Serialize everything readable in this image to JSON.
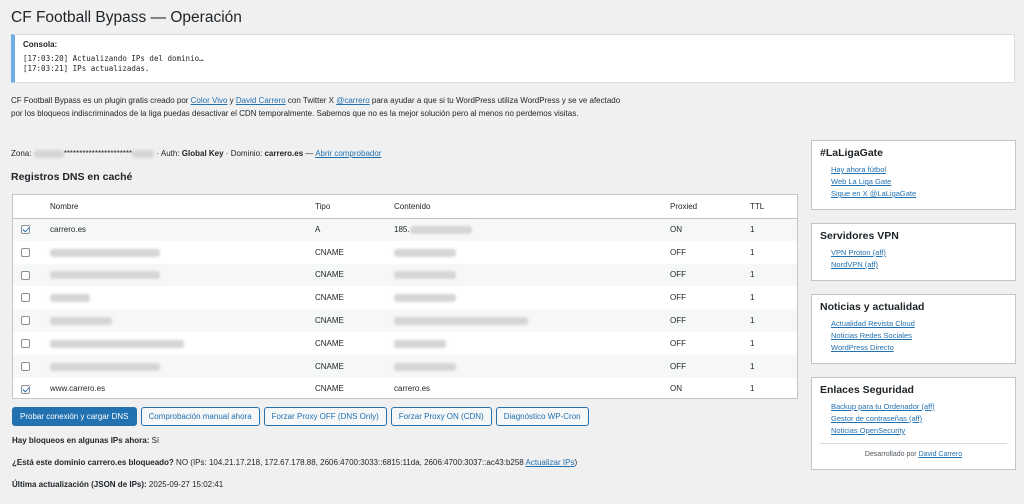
{
  "page_title": "CF Football Bypass — Operación",
  "console": {
    "label": "Consola:",
    "lines": [
      "[17:03:20] Actualizando IPs del dominio…",
      "[17:03:21] IPs actualizadas."
    ]
  },
  "intro": {
    "t1": "CF Football Bypass es un plugin gratis creado por ",
    "link1": "Color Vivo",
    "t2": " y ",
    "link2": "David Carrero",
    "t3": " con Twitter X ",
    "link3": "@carrero",
    "t4": " para ayudar a que si tu WordPress utiliza WordPress y se ve afectado por los bloqueos indiscriminados de la liga puedas desactivar el CDN temporalmente. Sabemos que no es la mejor solución pero al menos no perdemos visitas."
  },
  "zone": {
    "label": "Zona:",
    "masked": "**********************",
    "auth_prefix": " · Auth: ",
    "auth_value": "Global Key",
    "domain_prefix": " · Dominio: ",
    "domain_value": "carrero.es",
    "sep": " — ",
    "check_link": "Abrir comprobador"
  },
  "dns_heading": "Registros DNS en caché",
  "table": {
    "headers": [
      "Nombre",
      "Tipo",
      "Contenido",
      "Proxied",
      "TTL"
    ],
    "rows": [
      {
        "checked": true,
        "name": "carrero.es",
        "type": "A",
        "content": "185.",
        "proxied": "ON",
        "ttl": "1"
      },
      {
        "checked": false,
        "name": "",
        "type": "CNAME",
        "content": "",
        "proxied": "OFF",
        "ttl": "1"
      },
      {
        "checked": false,
        "name": "",
        "type": "CNAME",
        "content": "",
        "proxied": "OFF",
        "ttl": "1"
      },
      {
        "checked": false,
        "name": "",
        "type": "CNAME",
        "content": "",
        "proxied": "OFF",
        "ttl": "1"
      },
      {
        "checked": false,
        "name": "",
        "type": "CNAME",
        "content": "",
        "proxied": "OFF",
        "ttl": "1"
      },
      {
        "checked": false,
        "name": "",
        "type": "CNAME",
        "content": "",
        "proxied": "OFF",
        "ttl": "1"
      },
      {
        "checked": false,
        "name": "",
        "type": "CNAME",
        "content": "",
        "proxied": "OFF",
        "ttl": "1"
      },
      {
        "checked": true,
        "name": "www.carrero.es",
        "type": "CNAME",
        "content": "carrero.es",
        "proxied": "ON",
        "ttl": "1"
      }
    ]
  },
  "buttons": {
    "test": "Probar conexión y cargar DNS",
    "manual": "Comprobación manual ahora",
    "proxy_off": "Forzar Proxy OFF (DNS Only)",
    "proxy_on": "Forzar Proxy ON (CDN)",
    "cron": "Diagnóstico WP-Cron"
  },
  "status": {
    "blocks_label": "Hay bloqueos en algunas IPs ahora:",
    "blocks_value": " Sí",
    "domain_label": "¿Está este dominio carrero.es bloqueado?",
    "domain_value": " NO (IPs: 104.21.17.218, 172.67.178.88, 2606:4700:3033::6815:11da, 2606:4700:3037::ac43:b258 ",
    "domain_link": "Actualizar IPs",
    "domain_end": ")",
    "update_label": "Última actualización (JSON de IPs):",
    "update_value": " 2025-09-27 15:02:41"
  },
  "sidebar": {
    "laliga": {
      "title": "#LaLigaGate",
      "links": [
        "Hay ahora fútbol",
        "Web La Liga Gate",
        "Sigue en X @LaLigaGate"
      ]
    },
    "vpn": {
      "title": "Servidores VPN",
      "links": [
        "VPN Proton (aff)",
        "NordVPN (aff)"
      ]
    },
    "news": {
      "title": "Noticias y actualidad",
      "links": [
        "Actualidad Revista Cloud",
        "Noticias Redes Sociales",
        "WordPress Directo"
      ]
    },
    "security": {
      "title": "Enlaces Seguridad",
      "links": [
        "Backup para tu Ordenador (aff)",
        "Gestor de contraseñas (aff)",
        "Noticias OpenSecurity"
      ]
    },
    "footer_prefix": "Desarrollado por ",
    "footer_link": "David Carrero"
  }
}
